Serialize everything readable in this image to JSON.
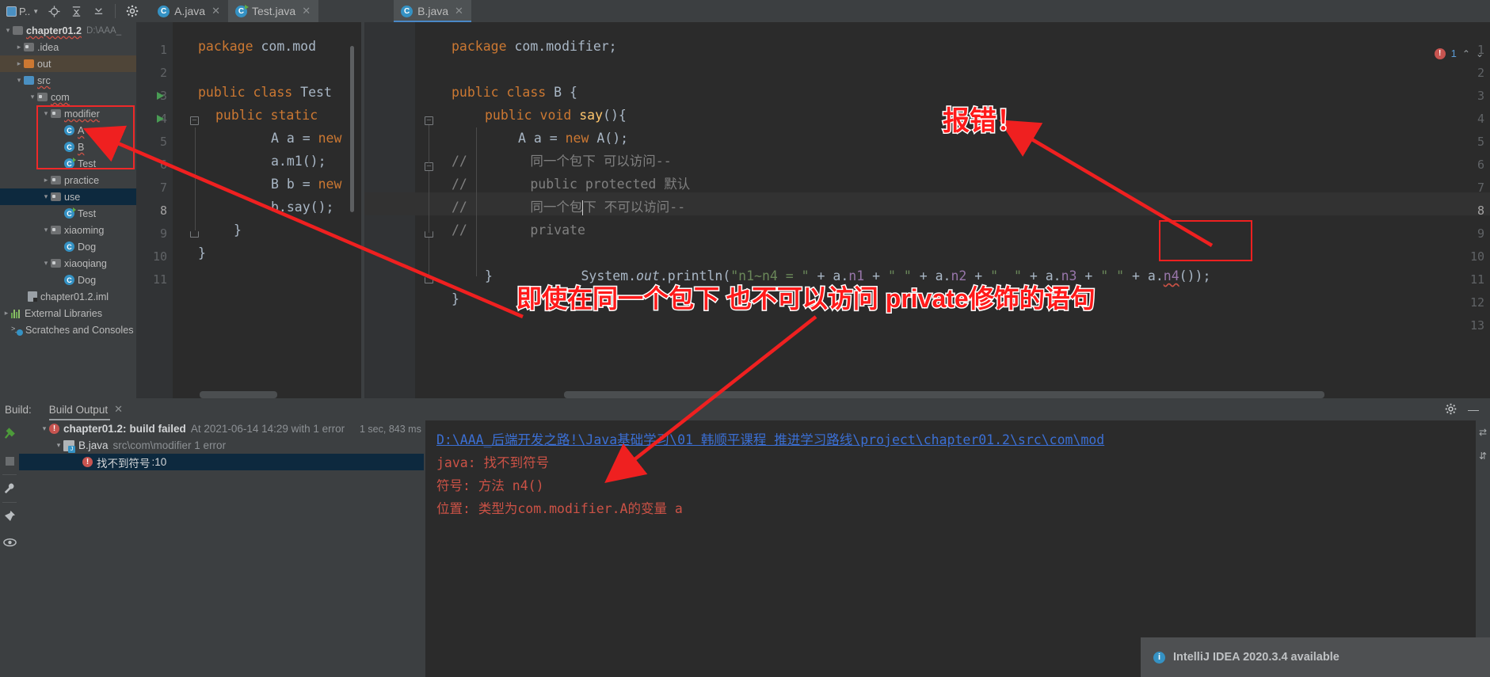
{
  "window": {
    "toolbar_icons": [
      "project-selector",
      "target-icon",
      "collapse-icon",
      "expand-icon",
      "settings-gear-icon"
    ],
    "project_button_label": "P..",
    "error_count": "1"
  },
  "tabs": [
    {
      "label": "A.java",
      "icon": "java-class-icon",
      "active": false,
      "runnable": false
    },
    {
      "label": "Test.java",
      "icon": "java-class-runnable-icon",
      "active": true,
      "runnable": true
    },
    {
      "label": "B.java",
      "icon": "java-class-icon",
      "active": true,
      "runnable": false
    }
  ],
  "project_tree": {
    "items": [
      {
        "label": "chapter01.2",
        "path": "D:\\AAA_",
        "indent": 0,
        "arrow": "down",
        "icon": "project-icon",
        "bold": true
      },
      {
        "label": ".idea",
        "indent": 1,
        "arrow": "right",
        "icon": "folder-icon"
      },
      {
        "label": "out",
        "indent": 1,
        "arrow": "right",
        "icon": "folder-orange-icon",
        "highlight": "out"
      },
      {
        "label": "src",
        "indent": 1,
        "arrow": "down",
        "icon": "folder-blue-icon",
        "wavy": true
      },
      {
        "label": "com",
        "indent": 2,
        "arrow": "down",
        "icon": "package-icon",
        "wavy": true
      },
      {
        "label": "modifier",
        "indent": 3,
        "arrow": "down",
        "icon": "package-icon",
        "wavy": true
      },
      {
        "label": "A",
        "indent": 4,
        "arrow": "none",
        "icon": "java-class-icon",
        "wavy": true
      },
      {
        "label": "B",
        "indent": 4,
        "arrow": "none",
        "icon": "java-class-icon",
        "wavy": true
      },
      {
        "label": "Test",
        "indent": 4,
        "arrow": "none",
        "icon": "java-class-runnable-icon"
      },
      {
        "label": "practice",
        "indent": 3,
        "arrow": "right",
        "icon": "package-icon"
      },
      {
        "label": "use",
        "indent": 3,
        "arrow": "down",
        "icon": "package-icon",
        "highlight": "use"
      },
      {
        "label": "Test",
        "indent": 4,
        "arrow": "none",
        "icon": "java-class-runnable-icon"
      },
      {
        "label": "xiaoming",
        "indent": 3,
        "arrow": "down",
        "icon": "package-icon"
      },
      {
        "label": "Dog",
        "indent": 4,
        "arrow": "none",
        "icon": "java-class-icon"
      },
      {
        "label": "xiaoqiang",
        "indent": 3,
        "arrow": "down",
        "icon": "package-icon"
      },
      {
        "label": "Dog",
        "indent": 4,
        "arrow": "none",
        "icon": "java-class-icon"
      },
      {
        "label": "chapter01.2.iml",
        "indent": 2,
        "arrow": "none",
        "icon": "iml-file-icon"
      },
      {
        "label": "External Libraries",
        "indent": 0,
        "arrow": "right",
        "icon": "libraries-icon"
      },
      {
        "label": "Scratches and Consoles",
        "indent": 0,
        "arrow": "none",
        "icon": "scratches-icon"
      }
    ]
  },
  "editor_left": {
    "filename": "Test.java",
    "lines": [
      {
        "n": "1",
        "text": "package com.mod"
      },
      {
        "n": "2",
        "text": ""
      },
      {
        "n": "3",
        "text": "public class Test"
      },
      {
        "n": "4",
        "text": "    public static"
      },
      {
        "n": "5",
        "text": "        A a = new"
      },
      {
        "n": "6",
        "text": "        a.m1();"
      },
      {
        "n": "7",
        "text": "        B b = new"
      },
      {
        "n": "8",
        "text": "        b.say();"
      },
      {
        "n": "9",
        "text": "    }"
      },
      {
        "n": "10",
        "text": "}"
      },
      {
        "n": "11",
        "text": ""
      }
    ]
  },
  "editor_right": {
    "filename": "B.java",
    "lines": [
      {
        "n": "1",
        "text": "package com.modifier;"
      },
      {
        "n": "2",
        "text": ""
      },
      {
        "n": "3",
        "text": "public class B {"
      },
      {
        "n": "4",
        "text": "    public void say(){"
      },
      {
        "n": "5",
        "text": "        A a = new A();"
      },
      {
        "n": "6",
        "text": "//        同一个包下 可以访问--"
      },
      {
        "n": "7",
        "text": "//        public protected 默认"
      },
      {
        "n": "8",
        "text": "//        同一个包下 不可以访问--"
      },
      {
        "n": "9",
        "text": "//        private"
      },
      {
        "n": "10",
        "text": "        System.out.println(\"n1~n4 = \" + a.n1 + \" \" + a.n2 + \"  \" + a.n3 + \" \" + a.n4());"
      },
      {
        "n": "11",
        "text": "    }"
      },
      {
        "n": "12",
        "text": "}"
      },
      {
        "n": "13",
        "text": ""
      }
    ],
    "println_parts": {
      "sysout_system": "System.",
      "sysout_out": "out",
      "sysout_println": ".println(",
      "str1": "\"n1~n4 = \"",
      "plus": " + ",
      "a": "a.",
      "n1": "n1",
      "n2": "n2",
      "n3": "n3",
      "n4": "n4",
      "q1": "\" \"",
      "q2": "\"  \"",
      "q3": "\" \"",
      "tail": "());"
    }
  },
  "build_panel": {
    "build_label": "Build:",
    "tab_label": "Build Output",
    "rows": [
      {
        "text": "chapter01.2:",
        "suffix": "build failed",
        "meta": "At 2021-06-14 14:29 with 1 error",
        "timing": "1 sec, 843 ms",
        "indent": 1,
        "icon": "error-icon",
        "arrow": "down"
      },
      {
        "text": "B.java",
        "meta": "src\\com\\modifier 1 error",
        "indent": 2,
        "icon": "java-file-icon",
        "arrow": "down"
      },
      {
        "text": "找不到符号",
        "meta": ":10",
        "indent": 3,
        "icon": "error-icon",
        "arrow": "none",
        "selected": true
      }
    ],
    "side_tools": [
      "build-icon",
      "stop-icon",
      "wrench-icon",
      "pin-icon",
      "eye-icon"
    ],
    "console": {
      "path_link": "D:\\AAA_后端开发之路!\\Java基础学习\\01  韩顺平课程  推进学习路线\\project\\chapter01.2\\src\\com\\mod",
      "line1": "java: 找不到符号",
      "line2": "  符号:   方法 n4()",
      "line3": "  位置: 类型为com.modifier.A的变量 a"
    }
  },
  "notification": {
    "icon": "info-icon",
    "text": "IntelliJ IDEA 2020.3.4 available"
  },
  "annotations": {
    "error_label": "报错！",
    "main_note": "即使在同一个包下 也不可以访问 private修饰的语句"
  },
  "colors": {
    "accent_red": "#ef2020",
    "keyword": "#cc7832",
    "string": "#6a8759",
    "field": "#9876aa",
    "method": "#ffc66d",
    "comment": "#808080",
    "plain": "#a9b7c6",
    "link_blue": "#3b6fd4",
    "error_red": "#cc5246"
  }
}
